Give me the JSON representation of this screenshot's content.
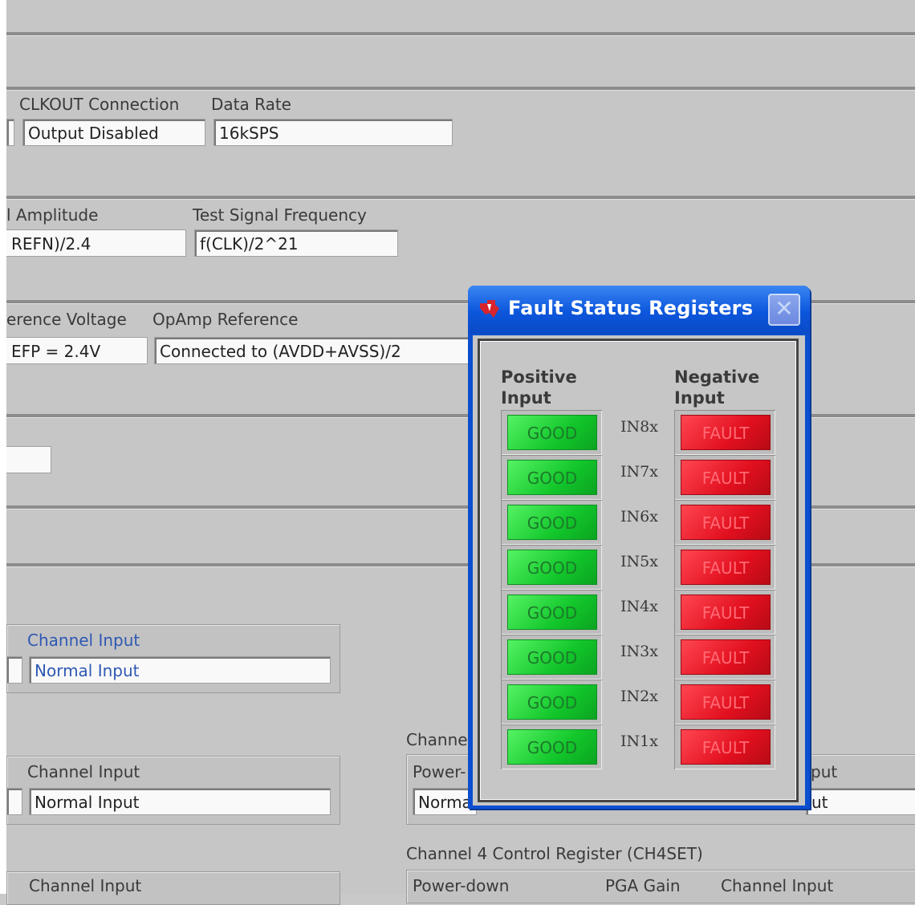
{
  "background": {
    "row1": {
      "clkout_label": "CLKOUT Connection",
      "clkout_value": "Output Disabled",
      "rate_label": "Data Rate",
      "rate_value": "16kSPS"
    },
    "row2": {
      "amp_label": "l Amplitude",
      "amp_value": "REFN)/2.4",
      "freq_label": "Test Signal Frequency",
      "freq_value": "f(CLK)/2^21"
    },
    "row3": {
      "ref_label": "erence Voltage",
      "ref_value": "EFP = 2.4V",
      "opamp_label": "OpAmp Reference",
      "opamp_value": "Connected to (AVDD+AVSS)/2"
    },
    "ch_blocks": [
      {
        "label": "Channel Input",
        "value": "Normal Input"
      },
      {
        "label": "Channel Input",
        "value": "Normal Input"
      },
      {
        "label": "Channel Input"
      }
    ],
    "right_block": {
      "heading_partial": "Channel",
      "power_partial": "Power-",
      "normal_partial": "Norma",
      "put_partial": "put",
      "ut_partial": "ut"
    },
    "ch4": {
      "heading": "Channel 4 Control Register (CH4SET)",
      "power_label": "Power-down",
      "gain_label": "PGA Gain",
      "input_label": "Channel Input"
    }
  },
  "dialog": {
    "title": "Fault Status Registers",
    "close_glyph": "✕",
    "positive_header": [
      "Positive",
      "Input"
    ],
    "negative_header": [
      "Negative",
      "Input"
    ],
    "rows": [
      {
        "channel": "IN8x",
        "positive": "GOOD",
        "negative": "FAULT"
      },
      {
        "channel": "IN7x",
        "positive": "GOOD",
        "negative": "FAULT"
      },
      {
        "channel": "IN6x",
        "positive": "GOOD",
        "negative": "FAULT"
      },
      {
        "channel": "IN5x",
        "positive": "GOOD",
        "negative": "FAULT"
      },
      {
        "channel": "IN4x",
        "positive": "GOOD",
        "negative": "FAULT"
      },
      {
        "channel": "IN3x",
        "positive": "GOOD",
        "negative": "FAULT"
      },
      {
        "channel": "IN2x",
        "positive": "GOOD",
        "negative": "FAULT"
      },
      {
        "channel": "IN1x",
        "positive": "GOOD",
        "negative": "FAULT"
      }
    ],
    "colors": {
      "good": "#12c72b",
      "fault": "#e2101f",
      "titlebar": "#0c56dc"
    }
  }
}
